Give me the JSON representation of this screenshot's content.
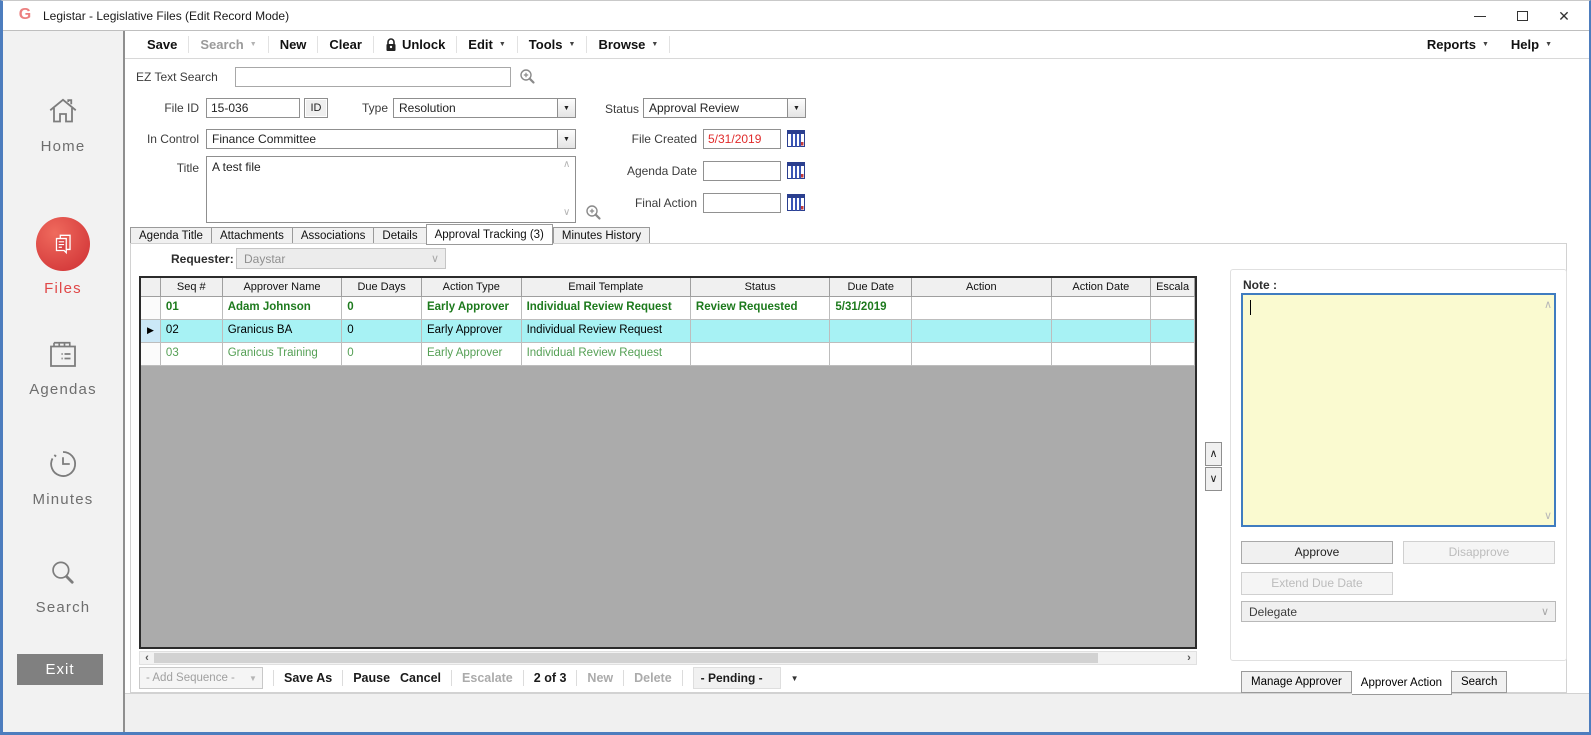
{
  "window": {
    "title": "Legistar - Legislative Files (Edit Record Mode)",
    "logo_letter": "G"
  },
  "menubar": {
    "items": [
      {
        "label": "Save"
      },
      {
        "label": "Search",
        "arrow": true,
        "disabled": true
      },
      {
        "label": "New"
      },
      {
        "label": "Clear"
      },
      {
        "label": "Unlock",
        "lock": true
      },
      {
        "label": "Edit",
        "arrow": true
      },
      {
        "label": "Tools",
        "arrow": true
      },
      {
        "label": "Browse",
        "arrow": true
      }
    ],
    "right_items": [
      {
        "label": "Reports",
        "arrow": true
      },
      {
        "label": "Help",
        "arrow": true
      }
    ]
  },
  "sidebar": {
    "items": [
      {
        "label": "Home"
      },
      {
        "label": "Files",
        "active": true
      },
      {
        "label": "Agendas"
      },
      {
        "label": "Minutes"
      },
      {
        "label": "Search"
      }
    ],
    "exit_label": "Exit"
  },
  "form": {
    "ez_search_label": "EZ Text Search",
    "ez_search_value": "",
    "file_id_label": "File ID",
    "file_id_value": "15-036",
    "id_button_label": "ID",
    "type_label": "Type",
    "type_value": "Resolution",
    "status_label": "Status",
    "status_value": "Approval Review",
    "in_control_label": "In Control",
    "in_control_value": "Finance Committee",
    "file_created_label": "File Created",
    "file_created_value": "5/31/2019",
    "title_label": "Title",
    "title_value": "A test file",
    "agenda_date_label": "Agenda Date",
    "agenda_date_value": "",
    "final_action_label": "Final Action",
    "final_action_value": ""
  },
  "tabs": {
    "items": [
      "Agenda Title",
      "Attachments",
      "Associations",
      "Details",
      "Approval Tracking (3)",
      "Minutes History"
    ],
    "active": "Approval Tracking (3)"
  },
  "approval": {
    "requester_label": "Requester:",
    "requester_value": "Daystar",
    "table": {
      "columns": [
        "Seq #",
        "Approver Name",
        "Due Days",
        "Action Type",
        "Email Template",
        "Status",
        "Due Date",
        "Action",
        "Action Date",
        "Escala"
      ],
      "rows": [
        {
          "cells": [
            "01",
            "Adam Johnson",
            "0",
            "Early Approver",
            "Individual Review Request",
            "Review Requested",
            "5/31/2019",
            "",
            "",
            ""
          ],
          "style": "bold-green",
          "selected": false
        },
        {
          "cells": [
            "02",
            "Granicus BA",
            "0",
            "Early Approver",
            "Individual Review Request",
            "",
            "",
            "",
            "",
            ""
          ],
          "style": "normal",
          "selected": true
        },
        {
          "cells": [
            "03",
            "Granicus Training",
            "0",
            "Early Approver",
            "Individual Review Request",
            "",
            "",
            "",
            "",
            ""
          ],
          "style": "green",
          "selected": false
        }
      ]
    }
  },
  "note_panel": {
    "label": "Note :",
    "note_value": "",
    "approve_label": "Approve",
    "disapprove_label": "Disapprove",
    "extend_label": "Extend Due Date",
    "delegate_label": "Delegate",
    "tabs": [
      "Manage Approver",
      "Approver Action",
      "Search"
    ],
    "active_tab": "Approver Action"
  },
  "toolbar": {
    "add_sequence": "- Add Sequence -",
    "save_as": "Save As",
    "pause": "Pause",
    "cancel": "Cancel",
    "escalate": "Escalate",
    "record_position": "2 of 3",
    "new": "New",
    "delete": "Delete",
    "pending": "- Pending -"
  },
  "icons": {
    "dropdown": "▼",
    "chevron_down": "∨",
    "chevron_up": "∧",
    "scroll_left": "‹",
    "scroll_right": "›",
    "row_pointer": "▶",
    "close": "✕"
  },
  "colors": {
    "accent_red": "#e04848",
    "selected_row": "#a7f2f4",
    "green_bold": "#1d7a1d",
    "green": "#55a055",
    "note_bg": "#fafad0",
    "note_border": "#3f7cc0",
    "date_red": "#e02b2b",
    "sidebar_bg": "#f2f2f2"
  }
}
